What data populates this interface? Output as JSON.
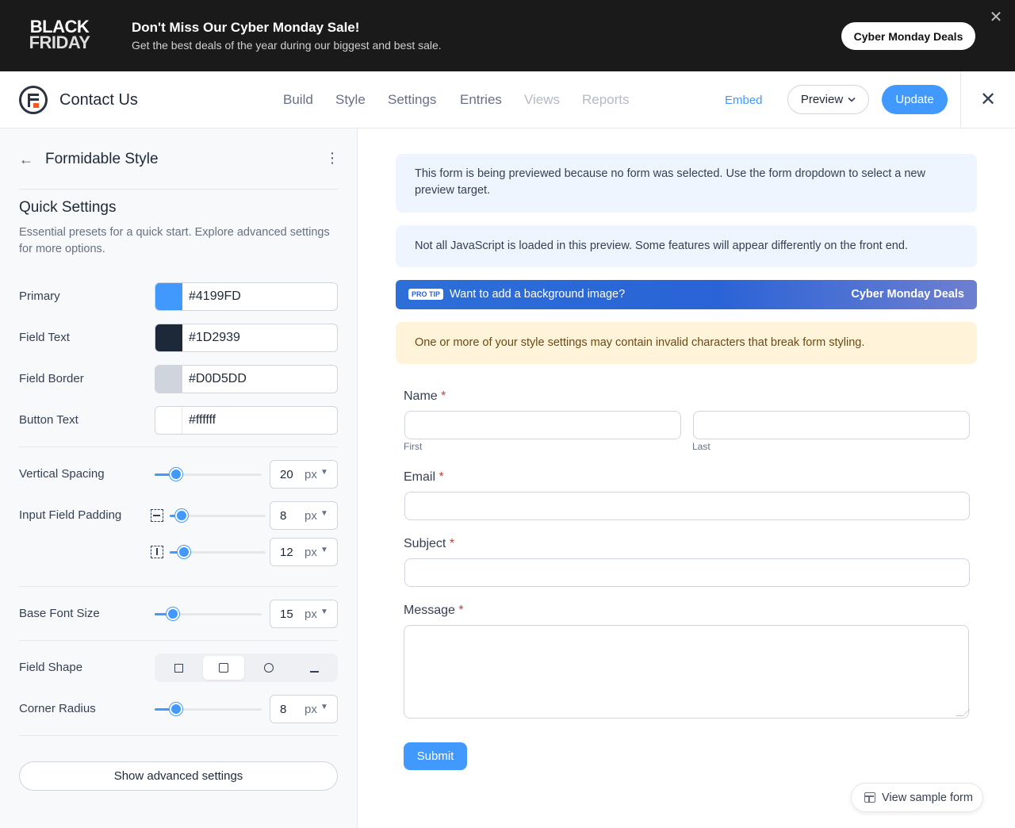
{
  "promo": {
    "logo_line1": "BLACK",
    "logo_line2": "FRIDAY",
    "title": "Don't Miss Our Cyber Monday Sale!",
    "subtitle": "Get the best deals of the year during our biggest and best sale.",
    "cta": "Cyber Monday Deals",
    "close_glyph": "✕"
  },
  "header": {
    "title": "Contact Us",
    "nav": [
      {
        "label": "Build",
        "enabled": true
      },
      {
        "label": "Style",
        "enabled": true
      },
      {
        "label": "Settings",
        "enabled": true
      },
      {
        "label": "Entries",
        "enabled": true
      },
      {
        "label": "Views",
        "enabled": false
      },
      {
        "label": "Reports",
        "enabled": false
      }
    ],
    "embed": "Embed",
    "preview": "Preview",
    "update": "Update",
    "close_glyph": "✕"
  },
  "sidebar": {
    "back_glyph": "←",
    "title": "Formidable Style",
    "menu_glyph": "⋮",
    "quick_settings_title": "Quick Settings",
    "quick_settings_desc": "Essential presets for a quick start. Explore advanced settings for more options.",
    "colors": [
      {
        "label": "Primary",
        "value": "#4199FD",
        "swatch": "#4199FD"
      },
      {
        "label": "Field Text",
        "value": "#1D2939",
        "swatch": "#1D2939"
      },
      {
        "label": "Field Border",
        "value": "#D0D5DD",
        "swatch": "#D0D5DD"
      },
      {
        "label": "Button Text",
        "value": "#ffffff",
        "swatch": "#ffffff"
      }
    ],
    "vertical_spacing": {
      "label": "Vertical Spacing",
      "value": "20",
      "unit": "px",
      "fraction": 0.2
    },
    "input_padding": {
      "label": "Input Field Padding",
      "vertical": {
        "value": "8",
        "unit": "px",
        "fraction": 0.12
      },
      "horizontal": {
        "value": "12",
        "unit": "px",
        "fraction": 0.15
      }
    },
    "base_font_size": {
      "label": "Base Font Size",
      "value": "15",
      "unit": "px",
      "fraction": 0.17
    },
    "field_shape": {
      "label": "Field Shape",
      "options": [
        "square",
        "rounded",
        "circle",
        "underline"
      ],
      "selected": "rounded"
    },
    "corner_radius": {
      "label": "Corner Radius",
      "value": "8",
      "unit": "px",
      "fraction": 0.2
    },
    "advanced_button": "Show advanced settings"
  },
  "main": {
    "notice_preview": "This form is being previewed because no form was selected. Use the form dropdown to select a new preview target.",
    "notice_js": "Not all JavaScript is loaded in this preview. Some features will appear differently on the front end.",
    "protip": {
      "badge": "PRO TIP",
      "text": "Want to add a background image?",
      "cta": "Cyber Monday Deals"
    },
    "warning": "One or more of your style settings may contain invalid characters that break form styling.",
    "form": {
      "name_label": "Name",
      "first_sub": "First",
      "last_sub": "Last",
      "email_label": "Email",
      "subject_label": "Subject",
      "message_label": "Message",
      "required_mark": "*",
      "submit": "Submit"
    },
    "sample_button": "View sample form"
  },
  "colors": {
    "accent": "#4199FD",
    "banner_bg": "#1a1a1a",
    "notice_bg": "#eef5ff",
    "warning_bg": "#fff3da",
    "required": "#e5321f"
  }
}
